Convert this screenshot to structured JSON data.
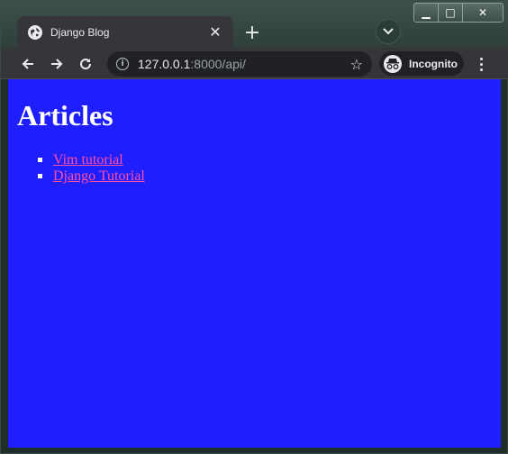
{
  "browser": {
    "tab": {
      "title": "Django Blog",
      "close_glyph": "✕"
    },
    "new_tab_glyph": "+",
    "address_bar": {
      "host": "127.0.0.1",
      "path": ":8000/api/"
    },
    "profile_label": "Incognito",
    "window_controls": {
      "minimize": "▁",
      "maximize": "□",
      "close": "✕"
    }
  },
  "page": {
    "heading": "Articles",
    "articles": [
      {
        "title": "Vim tutorial"
      },
      {
        "title": "Django Tutorial"
      }
    ],
    "background_color": "#1e1eff",
    "link_color": "#ff4fa3"
  }
}
